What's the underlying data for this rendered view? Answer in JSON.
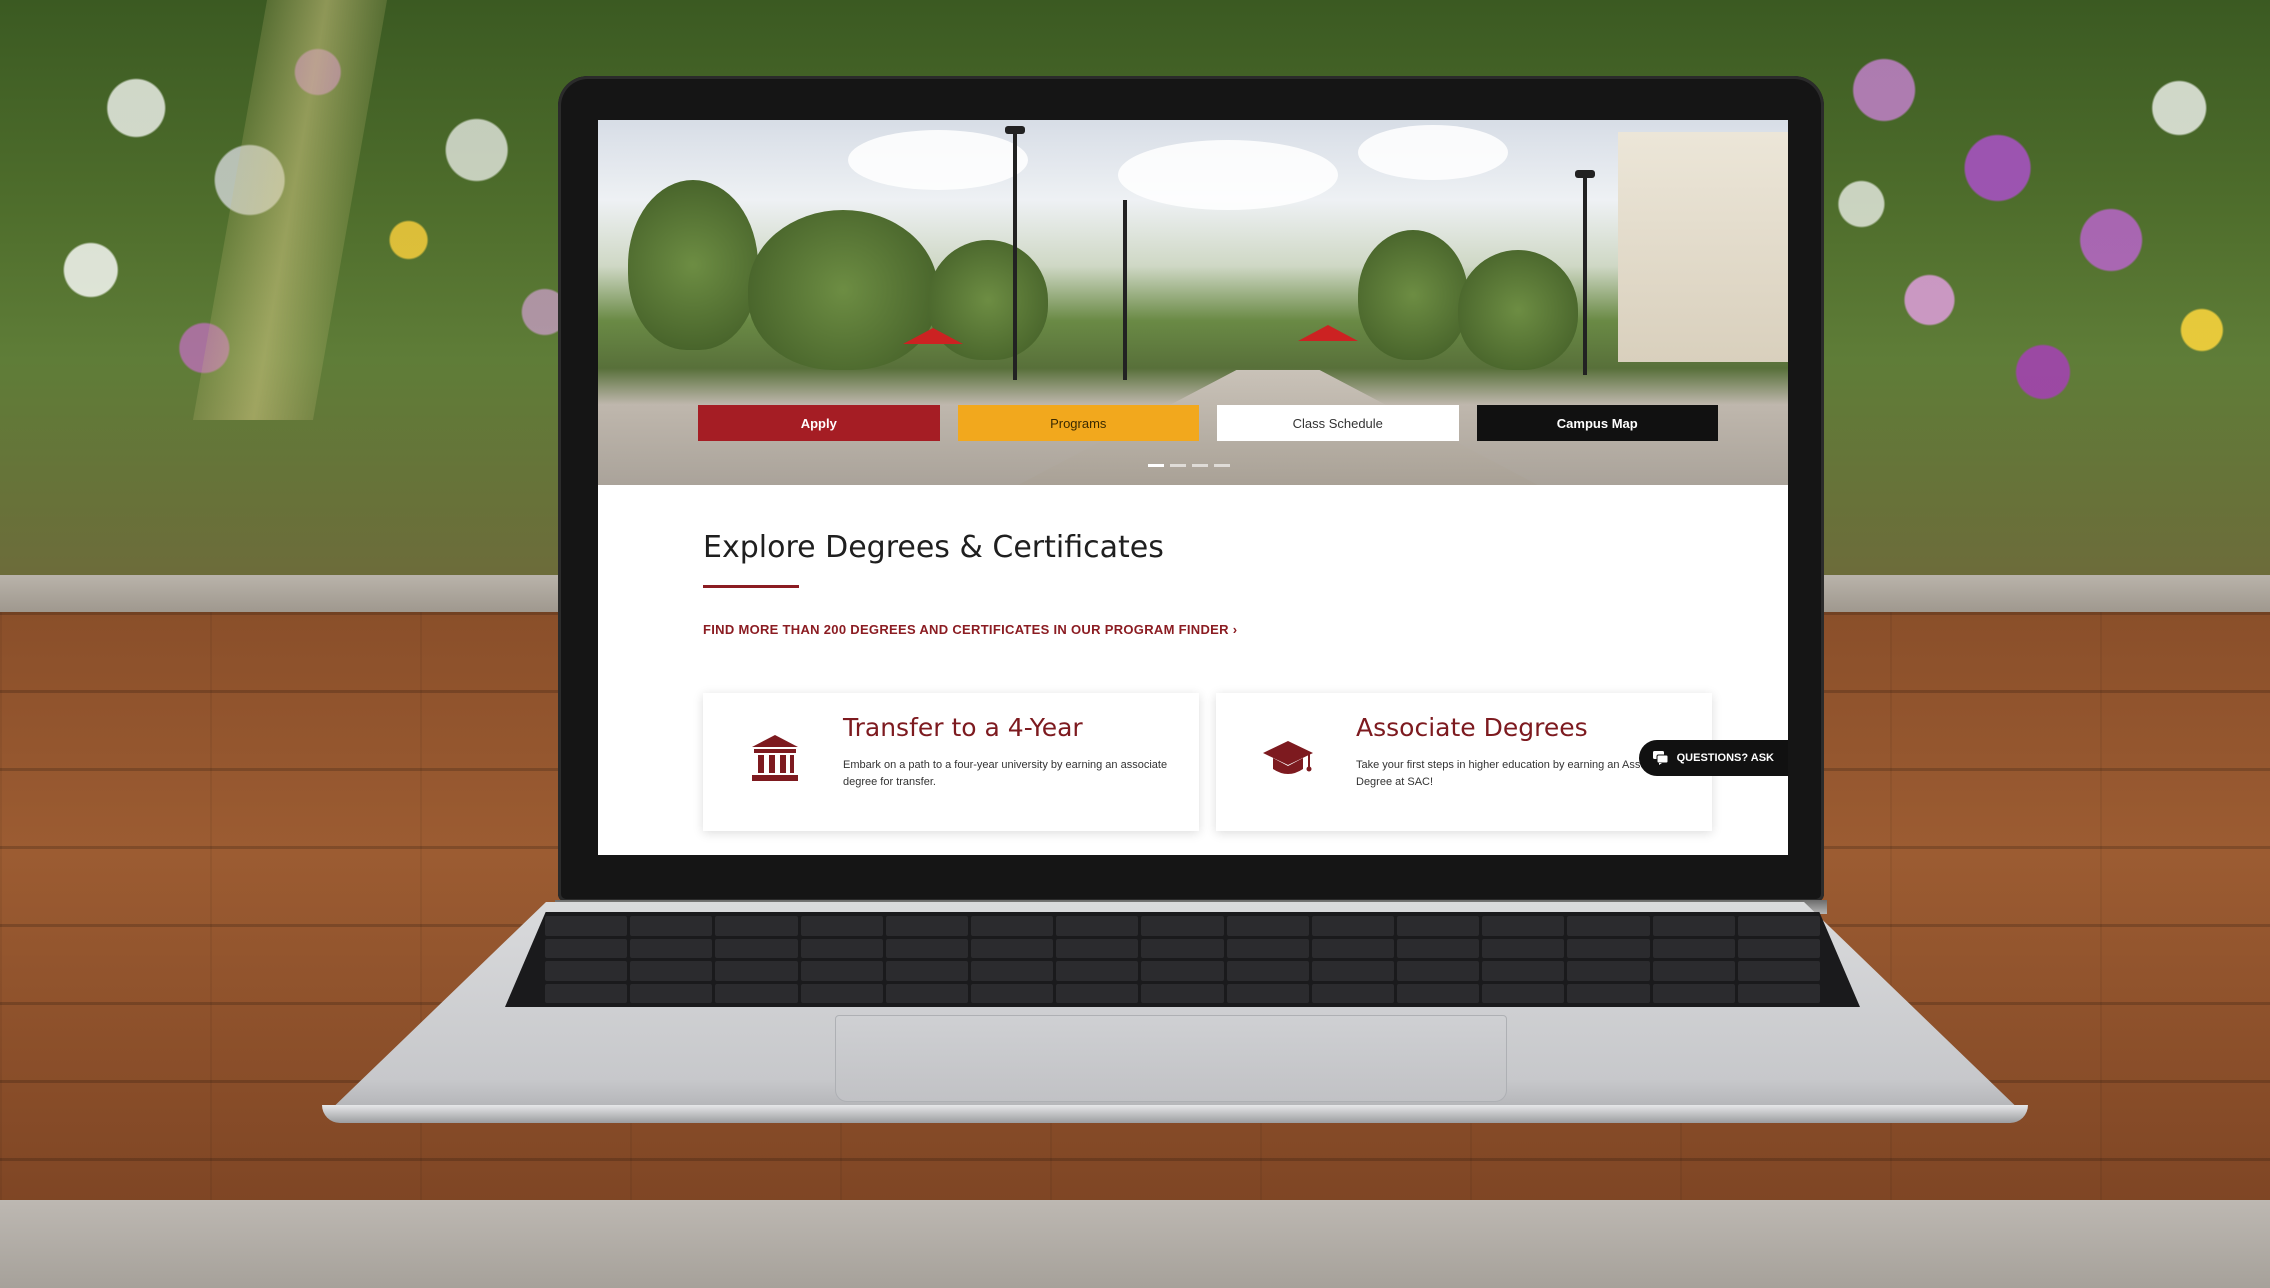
{
  "hero": {
    "buttons": {
      "apply": "Apply",
      "programs": "Programs",
      "class_schedule": "Class Schedule",
      "campus_map": "Campus Map"
    }
  },
  "section": {
    "title": "Explore Degrees & Certificates",
    "finder_link": "FIND MORE THAN 200 DEGREES AND CERTIFICATES IN OUR PROGRAM FINDER"
  },
  "cards": [
    {
      "title": "Transfer to a 4-Year",
      "description": "Embark on a path to a four-year university by earning an associate degree for transfer.",
      "icon": "university-building-icon"
    },
    {
      "title": "Associate Degrees",
      "description": "Take your first steps in higher education by earning an Associate Degree at SAC!",
      "icon": "graduation-cap-icon"
    }
  ],
  "chat": {
    "label": "QUESTIONS? ASK",
    "icon": "chat-bubble-icon"
  },
  "colors": {
    "brand_red": "#8b1c22",
    "apply_red": "#a51d24",
    "programs_gold": "#f2a81d",
    "campus_map_black": "#111111"
  }
}
